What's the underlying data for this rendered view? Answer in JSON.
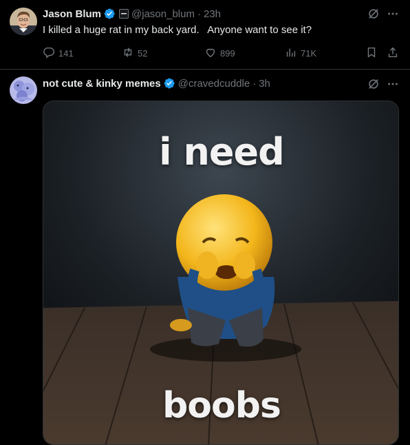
{
  "tweets": [
    {
      "author_name": "Jason Blum",
      "handle": "@jason_blum",
      "separator": "·",
      "time": "23h",
      "text": "I killed a huge rat in my back yard.   Anyone want to see it?",
      "replies": "141",
      "reposts": "52",
      "likes": "899",
      "views": "71K"
    },
    {
      "author_name": "not cute & kinky memes",
      "handle": "@cravedcuddle",
      "separator": "·",
      "time": "3h",
      "image_caption_top": "i need",
      "image_caption_bottom": "boobs"
    }
  ],
  "icons": {
    "verified": "verified-badge-icon",
    "affiliate": "affiliate-badge-icon",
    "grok": "grok-icon",
    "more": "more-icon",
    "reply": "reply-icon",
    "repost": "repost-icon",
    "like": "like-icon",
    "views": "views-icon",
    "bookmark": "bookmark-icon",
    "share": "share-icon"
  },
  "colors": {
    "background": "#000000",
    "text": "#e7e9ea",
    "muted": "#71767b",
    "verified": "#1d9bf0",
    "border": "#2f3336"
  }
}
